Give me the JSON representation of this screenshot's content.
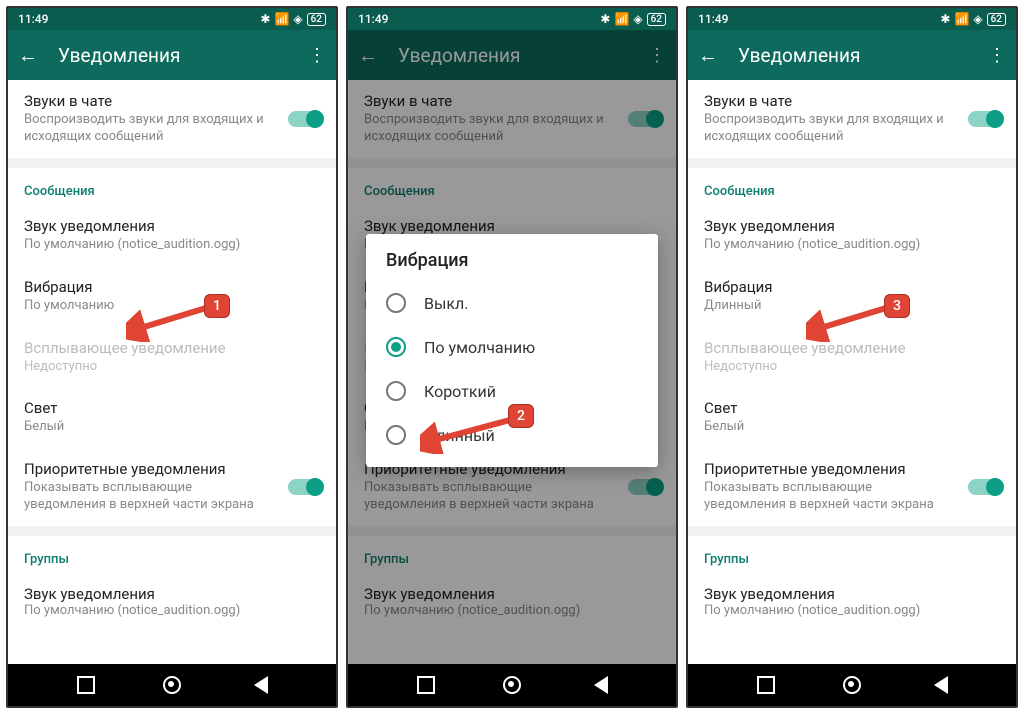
{
  "status": {
    "time": "11:49",
    "battery": "62"
  },
  "appbar": {
    "title": "Уведомления"
  },
  "chatSounds": {
    "title": "Звуки в чате",
    "desc": "Воспроизводить звуки для входящих и исходящих сообщений"
  },
  "sectionMessages": "Сообщения",
  "notifSound": {
    "title": "Звук уведомления",
    "desc": "По умолчанию (notice_audition.ogg)"
  },
  "vibration": {
    "title": "Вибрация",
    "value_default": "По умолчанию",
    "value_long": "Длинный"
  },
  "popup": {
    "title": "Всплывающее уведомление",
    "desc": "Недоступно"
  },
  "light": {
    "title": "Свет",
    "desc": "Белый"
  },
  "priority": {
    "title": "Приоритетные уведомления",
    "desc": "Показывать всплывающие уведомления в верхней части экрана"
  },
  "sectionGroups": "Группы",
  "groupSound": {
    "title": "Звук уведомления",
    "desc": "По умолчанию (notice_audition.ogg)"
  },
  "dialog": {
    "title": "Вибрация",
    "opts": [
      "Выкл.",
      "По умолчанию",
      "Короткий",
      "Длинный"
    ]
  },
  "badges": {
    "b1": "1",
    "b2": "2",
    "b3": "3"
  }
}
